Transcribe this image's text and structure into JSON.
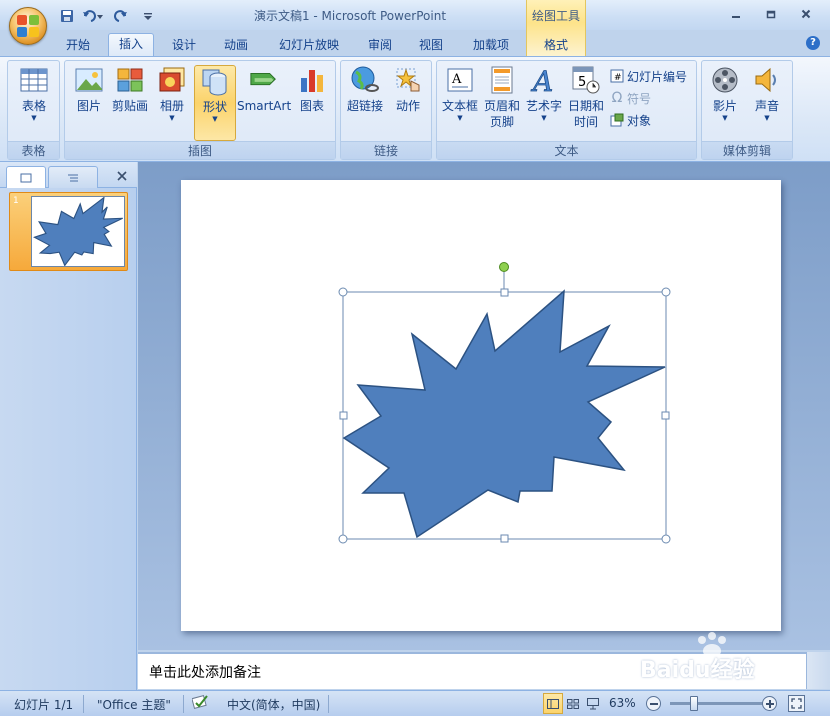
{
  "title": "演示文稿1 - Microsoft PowerPoint",
  "contextual_tab_label": "绘图工具",
  "tabs": [
    "开始",
    "插入",
    "设计",
    "动画",
    "幻灯片放映",
    "审阅",
    "视图",
    "加载项",
    "格式"
  ],
  "active_tab": "插入",
  "ribbon": {
    "groups": {
      "table": "表格",
      "illustrations": "插图",
      "links": "链接",
      "text": "文本",
      "media": "媒体剪辑"
    },
    "buttons": {
      "table": "表格",
      "picture": "图片",
      "clipart": "剪贴画",
      "album": "相册",
      "shapes": "形状",
      "smartart": "SmartArt",
      "chart": "图表",
      "hyperlink": "超链接",
      "action": "动作",
      "textbox": "文本框",
      "header_footer_1": "页眉和",
      "header_footer_2": "页脚",
      "wordart": "艺术字",
      "datetime_1": "日期和",
      "datetime_2": "时间",
      "slide_number": "幻灯片编号",
      "symbol": "符号",
      "object": "对象",
      "movie": "影片",
      "sound": "声音"
    }
  },
  "thumbnail": {
    "number": "1"
  },
  "notes_placeholder": "单击此处添加备注",
  "status": {
    "slide": "幻灯片 1/1",
    "theme": "\"Office 主题\"",
    "language": "中文(简体，中国)",
    "zoom": "63%"
  },
  "watermark": "Baidu经验",
  "colors": {
    "shape_fill": "#4f7fbd",
    "shape_stroke": "#2c5282",
    "selection": "#6b8ab0",
    "rotate_handle": "#8ed04f"
  }
}
